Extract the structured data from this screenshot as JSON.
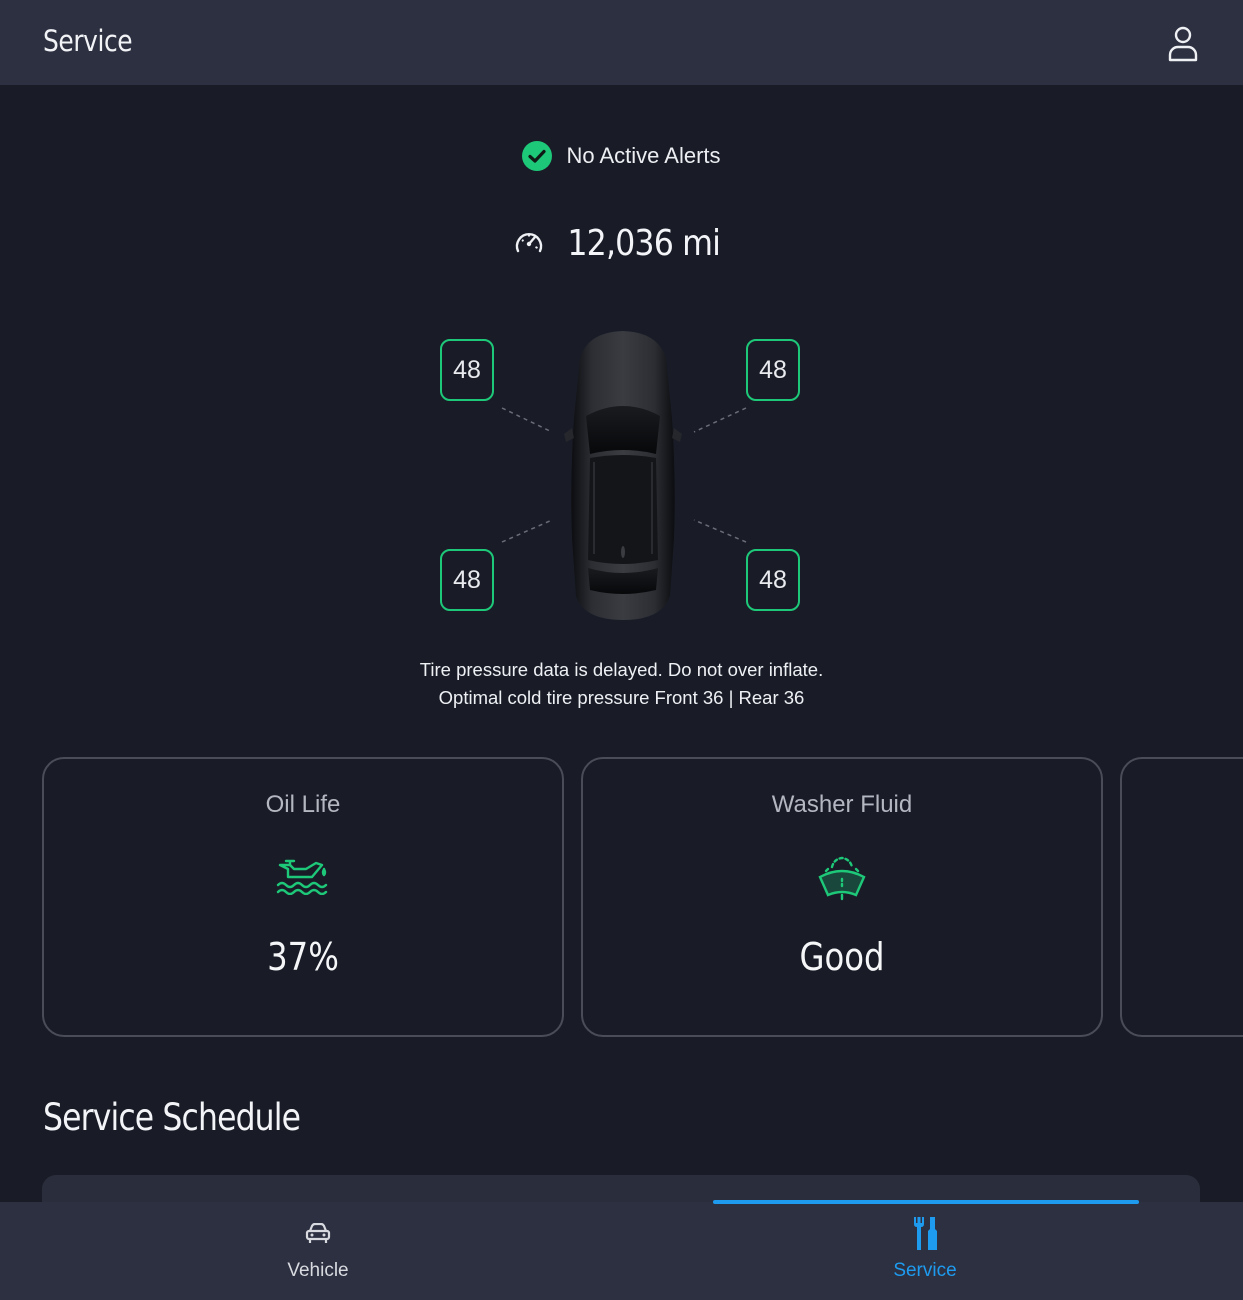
{
  "header": {
    "title": "Service",
    "profile_icon": "person-icon"
  },
  "alerts": {
    "text": "No Active Alerts",
    "icon": "check-circle-icon",
    "color": "#1ec879"
  },
  "odometer": {
    "value": "12,036 mi",
    "icon": "speedometer-icon"
  },
  "tires": {
    "front_left": "48",
    "front_right": "48",
    "rear_left": "48",
    "rear_right": "48",
    "border_color": "#1ec879",
    "note_line1": "Tire pressure data is delayed. Do not over inflate.",
    "note_line2": "Optimal cold tire pressure Front 36 | Rear 36"
  },
  "cards": {
    "oil": {
      "title": "Oil Life",
      "value": "37%",
      "icon": "oil-can-icon"
    },
    "washer": {
      "title": "Washer Fluid",
      "value": "Good",
      "icon": "windshield-washer-icon"
    }
  },
  "schedule": {
    "title": "Service Schedule"
  },
  "nav": {
    "vehicle_label": "Vehicle",
    "service_label": "Service",
    "active_color": "#1e9bef",
    "inactive_color": "#d8dae0"
  }
}
